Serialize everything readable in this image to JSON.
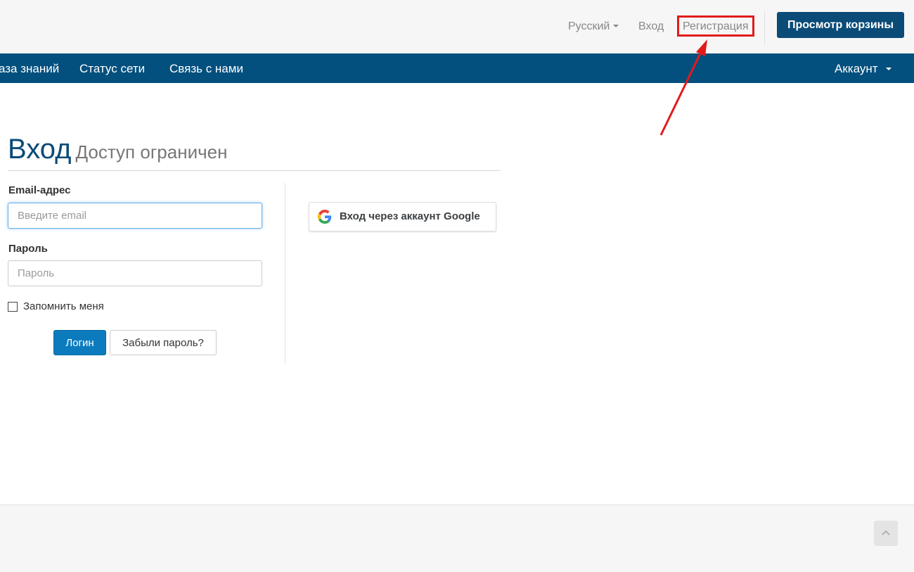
{
  "topbar": {
    "language": "Русский",
    "login": "Вход",
    "register": "Регистрация",
    "view_cart": "Просмотр корзины"
  },
  "navbar": {
    "items": [
      "аза знаний",
      "Статус сети",
      "Связь с нами"
    ],
    "account": "Аккаунт"
  },
  "page": {
    "title": "Вход",
    "subtitle": "Доступ ограничен"
  },
  "form": {
    "email_label": "Email-адрес",
    "email_placeholder": "Введите email",
    "password_label": "Пароль",
    "password_placeholder": "Пароль",
    "remember_me": "Запомнить меня",
    "remember_checked": false,
    "login_button": "Логин",
    "forgot_button": "Забыли пароль?"
  },
  "social": {
    "google_button": "Вход через аккаунт Google"
  },
  "colors": {
    "brand": "#0a4b78",
    "nav_bg": "#03507e",
    "primary_button": "#0c7bbd",
    "annotation": "#e11b1b"
  }
}
